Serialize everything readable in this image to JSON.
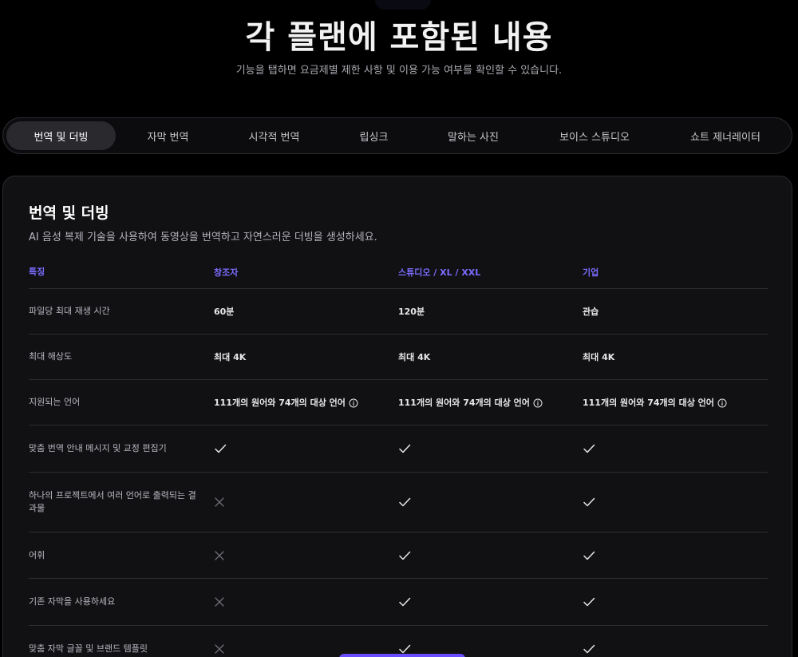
{
  "hero": {
    "title": "각 플랜에 포함된 내용",
    "subtitle": "기능을 탭하면 요금제별 제한 사항 및 이용 가능 여부를 확인할 수 있습니다."
  },
  "tabs": [
    {
      "label": "번역 및 더빙",
      "active": true
    },
    {
      "label": "자막 번역",
      "active": false
    },
    {
      "label": "시각적 번역",
      "active": false
    },
    {
      "label": "립싱크",
      "active": false
    },
    {
      "label": "말하는 사진",
      "active": false
    },
    {
      "label": "보이스 스튜디오",
      "active": false
    },
    {
      "label": "쇼트 제너레이터",
      "active": false
    }
  ],
  "section": {
    "title": "번역 및 더빙",
    "description": "AI 음성 복제 기술을 사용하여 동영상을 번역하고 자연스러운 더빙을 생성하세요."
  },
  "table": {
    "headers": [
      "특징",
      "창조자",
      "스튜디오 / XL / XXL",
      "기업"
    ],
    "rows": [
      {
        "feature": "파일당 최대 재생 시간",
        "values": [
          "60분",
          "120분",
          "관습"
        ]
      },
      {
        "feature": "최대 해상도",
        "values": [
          "최대 4K",
          "최대 4K",
          "최대 4K"
        ]
      },
      {
        "feature": "지원되는 언어",
        "values": [
          "111개의 원어와 74개의 대상 언어",
          "111개의 원어와 74개의 대상 언어",
          "111개의 원어와 74개의 대상 언어"
        ]
      },
      {
        "feature": "맞춤 번역 안내 메시지 및 교정 편집기",
        "values": [
          "check",
          "check",
          "check"
        ]
      },
      {
        "feature": "하나의 프로젝트에서 여러 언어로 출력되는 결과물",
        "values": [
          "cross",
          "check",
          "check"
        ]
      },
      {
        "feature": "어휘",
        "values": [
          "cross",
          "check",
          "check"
        ]
      },
      {
        "feature": "기존 자막을 사용하세요",
        "values": [
          "cross",
          "check",
          "check"
        ]
      },
      {
        "feature": "맞춤 자막 글꼴 및 브랜드 템플릿",
        "values": [
          "cross",
          "check",
          "check"
        ]
      }
    ]
  },
  "colors": {
    "accent": "#7b6cff",
    "background": "#000000",
    "card": "#111114"
  }
}
